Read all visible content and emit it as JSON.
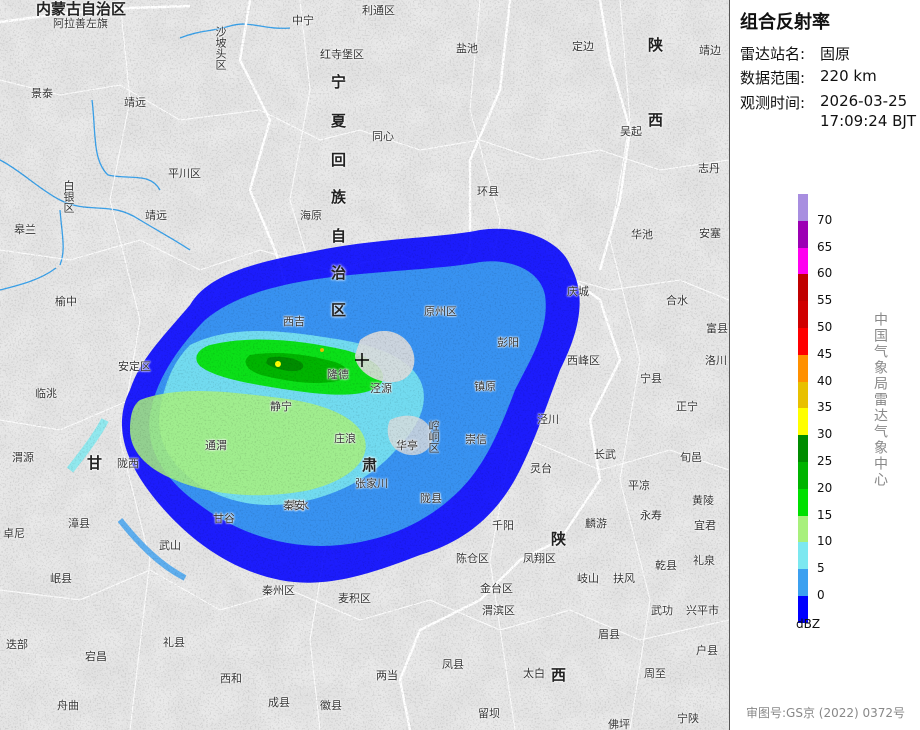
{
  "panel": {
    "title": "组合反射率",
    "station_label": "雷达站名:",
    "station_value": "固原",
    "range_label": "数据范围:",
    "range_value": "220 km",
    "time_label": "观测时间:",
    "time_date": "2026-03-25",
    "time_clock": "17:09:24 BJT",
    "unit": "dBZ",
    "agency": "中国气象局雷达气象中心",
    "approval": "审图号:GS京 (2022) 0372号"
  },
  "legend": {
    "colors": [
      "#a88ee0",
      "#9c00b4",
      "#ff00f0",
      "#c00000",
      "#d00000",
      "#ff0000",
      "#ff9000",
      "#e8c000",
      "#ffff00",
      "#008c00",
      "#00b400",
      "#00e000",
      "#a8f07c",
      "#7ce8f0",
      "#3ca0f0",
      "#0000ff"
    ],
    "ticks": [
      "70",
      "65",
      "60",
      "55",
      "50",
      "45",
      "40",
      "35",
      "30",
      "25",
      "20",
      "15",
      "10",
      "5",
      "0"
    ]
  },
  "map": {
    "provinces": {
      "neimenggu": "内蒙古自治区",
      "ningxia": [
        "宁",
        "夏",
        "回",
        "族",
        "自",
        "治",
        "区"
      ],
      "gansu": [
        "甘",
        "肃"
      ],
      "shaanxi_n": "陕",
      "shaanxi_s": "西",
      "shaanxi_b1": "陕",
      "shaanxi_b2": "西"
    },
    "places": [
      "阿拉善左旗",
      "中宁",
      "利通区",
      "红寺堡区",
      "盐池",
      "定边",
      "靖边",
      "景泰",
      "靖远",
      "同心",
      "吴起",
      "志丹",
      "平川区",
      "海原",
      "环县",
      "白银区",
      "皋兰",
      "靖远",
      "西吉",
      "华池",
      "安塞",
      "榆中",
      "原州区",
      "彭阳",
      "庆城",
      "合水",
      "富县",
      "安定区",
      "隆德",
      "泾源",
      "镇原",
      "西峰区",
      "宁县",
      "洛川",
      "临洮",
      "静宁",
      "庄浪",
      "崆峒区",
      "泾川",
      "正宁",
      "渭源",
      "陇西",
      "通渭",
      "华亭",
      "崇信",
      "灵台",
      "长武",
      "旬邑",
      "黄陵",
      "张家川",
      "清水",
      "麟游",
      "永寿",
      "宜君",
      "漳县",
      "甘谷",
      "秦安",
      "千阳",
      "陇县",
      "礼泉",
      "岷县",
      "武山",
      "陈仓区",
      "凤翔区",
      "乾县",
      "卓尼",
      "秦州区",
      "麦积区",
      "金台区",
      "岐山",
      "扶风",
      "武功",
      "兴平市",
      "迭部",
      "礼县",
      "渭滨区",
      "眉县",
      "宕昌",
      "西和",
      "两当",
      "凤县",
      "周至",
      "舟曲",
      "成县",
      "徽县",
      "留坝",
      "佛坪",
      "宁陕",
      "太白",
      "户县",
      "沙坡头区",
      "平凉"
    ],
    "small_vertical": [
      "沙坡头区",
      "白银区",
      "崆峒区"
    ]
  }
}
